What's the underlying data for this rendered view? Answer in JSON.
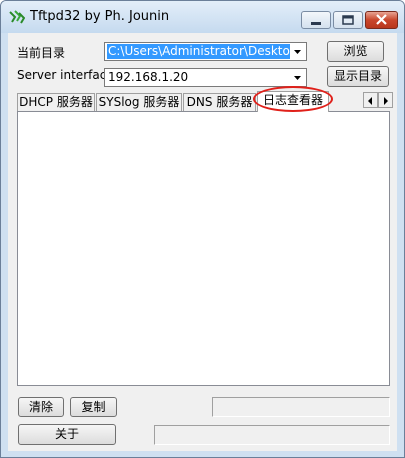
{
  "window": {
    "title": "Tftpd32 by Ph. Jounin"
  },
  "form": {
    "current_dir_label": "当前目录",
    "current_dir_value": "C:\\Users\\Administrator\\Desktop\\ha_T(",
    "server_interface_label": "Server interface",
    "server_interface_value": "192.168.1.20",
    "browse_button": "浏览",
    "show_dir_button": "显示目录"
  },
  "tabs": [
    {
      "label": "DHCP 服务器",
      "active": false
    },
    {
      "label": "SYSlog 服务器",
      "active": false
    },
    {
      "label": "DNS 服务器",
      "active": false
    },
    {
      "label": "日志查看器",
      "active": true
    }
  ],
  "log_panel": {
    "clear_button": "清除",
    "copy_button": "复制"
  },
  "footer": {
    "about_button": "关于"
  },
  "colors": {
    "selection": "#3399ff",
    "annotation_oval": "#e0201a",
    "close_button": "#c9462c"
  }
}
